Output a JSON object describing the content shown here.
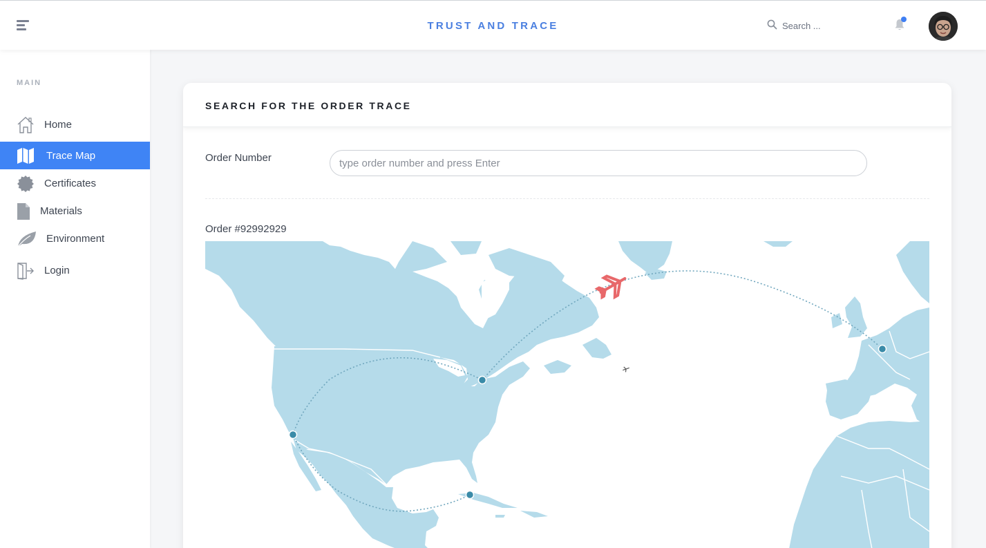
{
  "header": {
    "brand": "TRUST AND TRACE",
    "search_placeholder": "Search ...",
    "icons": [
      "menu-icon",
      "search-icon",
      "bell-icon"
    ]
  },
  "sidebar": {
    "section_title": "MAIN",
    "items": [
      {
        "label": "Home",
        "icon": "home-icon",
        "active": false
      },
      {
        "label": "Trace Map",
        "icon": "map-icon",
        "active": true
      },
      {
        "label": "Certificates",
        "icon": "certificate-icon",
        "active": false
      },
      {
        "label": "Materials",
        "icon": "document-icon",
        "active": false
      },
      {
        "label": "Environment",
        "icon": "leaf-icon",
        "active": false
      },
      {
        "label": "Login",
        "icon": "login-icon",
        "active": false
      }
    ]
  },
  "main": {
    "card_title": "SEARCH FOR THE ORDER TRACE",
    "order_number_label": "Order Number",
    "order_input_placeholder": "type order number and press Enter",
    "order_title": "Order #92992929"
  },
  "colors": {
    "accent": "#3f84f5",
    "brand": "#4a7fe0",
    "land": "#b5dbea",
    "route": "#7fb3c8",
    "marker": "#3a8ba8",
    "plane": "#e8686a"
  }
}
